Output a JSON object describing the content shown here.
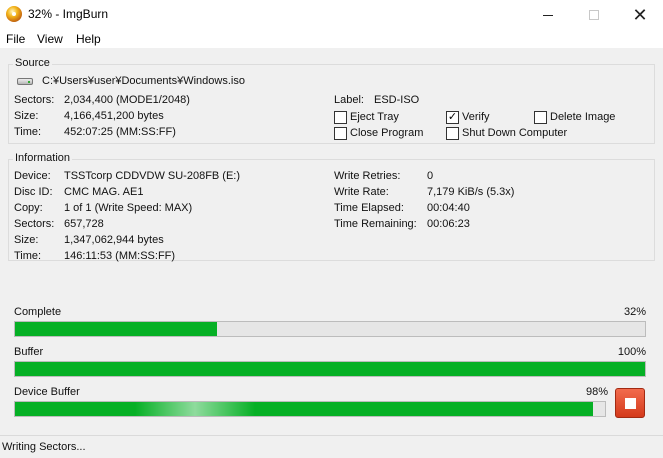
{
  "window": {
    "title": "32% - ImgBurn",
    "close_glyph": "✕"
  },
  "menu": {
    "file": "File",
    "view": "View",
    "help": "Help"
  },
  "source": {
    "group_title": "Source",
    "path": "C:¥Users¥user¥Documents¥Windows.iso",
    "sectors_label": "Sectors:",
    "sectors_value": "2,034,400 (MODE1/2048)",
    "size_label": "Size:",
    "size_value": "4,166,451,200 bytes",
    "time_label": "Time:",
    "time_value": "452:07:25 (MM:SS:FF)",
    "volume_label_label": "Label:",
    "volume_label_value": "ESD-ISO",
    "options": [
      {
        "label": "Eject Tray",
        "checked": false
      },
      {
        "label": "Verify",
        "checked": true
      },
      {
        "label": "Delete Image",
        "checked": false
      },
      {
        "label": "Close Program",
        "checked": false
      },
      {
        "label": "Shut Down Computer",
        "checked": false
      }
    ]
  },
  "information": {
    "group_title": "Information",
    "device_label": "Device:",
    "device_value": "TSSTcorp CDDVDW SU-208FB (E:)",
    "disc_id_label": "Disc ID:",
    "disc_id_value": "CMC MAG. AE1",
    "copy_label": "Copy:",
    "copy_value": "1 of 1 (Write Speed: MAX)",
    "sectors_label": "Sectors:",
    "sectors_value": "657,728",
    "size_label": "Size:",
    "size_value": "1,347,062,944 bytes",
    "time_label": "Time:",
    "time_value": "146:11:53 (MM:SS:FF)",
    "write_retries_label": "Write Retries:",
    "write_retries_value": "0",
    "write_rate_label": "Write Rate:",
    "write_rate_value": "7,179 KiB/s (5.3x)",
    "time_elapsed_label": "Time Elapsed:",
    "time_elapsed_value": "00:04:40",
    "time_remaining_label": "Time Remaining:",
    "time_remaining_value": "00:06:23"
  },
  "progress": {
    "complete_label": "Complete",
    "complete_percent_text": "32%",
    "complete_fraction": 0.32,
    "buffer_label": "Buffer",
    "buffer_percent_text": "100%",
    "buffer_fraction": 1.0,
    "device_buffer_label": "Device Buffer",
    "device_buffer_percent_text": "98%",
    "device_buffer_fraction": 0.98
  },
  "status": {
    "text": "Writing Sectors..."
  },
  "colors": {
    "progress_green": "#06b025",
    "stop_button": "#e04a2a"
  },
  "icons": [
    "imgburn-app-icon",
    "optical-drive-icon",
    "stop-icon"
  ]
}
